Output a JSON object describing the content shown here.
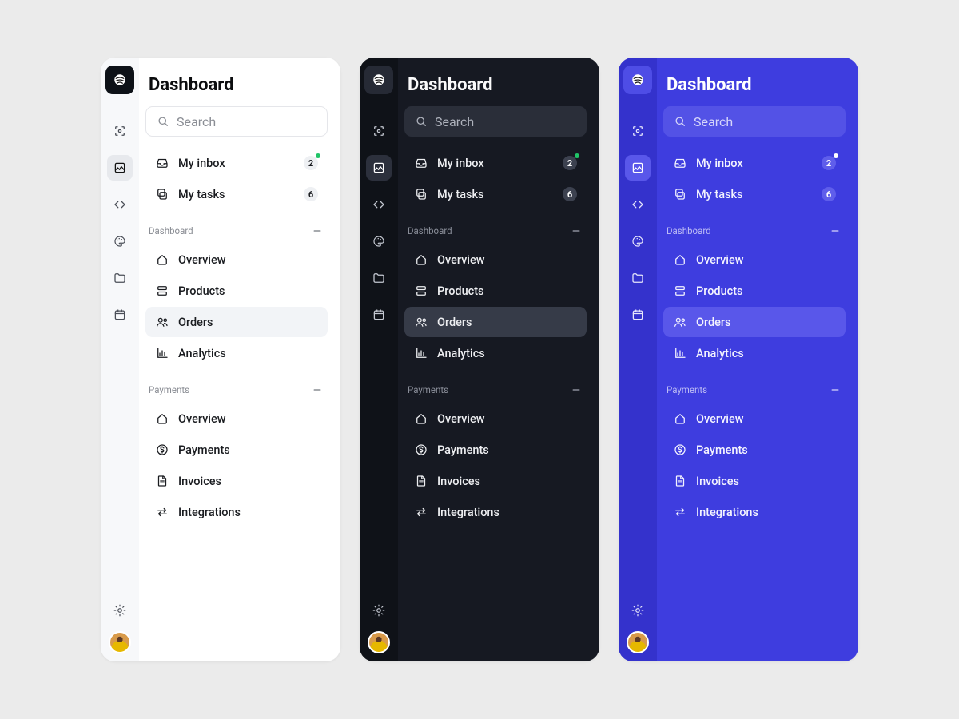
{
  "title": "Dashboard",
  "search_placeholder": "Search",
  "rail_icons": [
    "scan-icon",
    "image-icon",
    "code-icon",
    "palette-icon",
    "folder-icon",
    "calendar-icon"
  ],
  "rail_selected_index": 1,
  "rail_footer_icon": "gear-icon",
  "personal": [
    {
      "icon": "inbox-icon",
      "label": "My inbox",
      "count": "2",
      "dot": true
    },
    {
      "icon": "tasks-icon",
      "label": "My tasks",
      "count": "6",
      "dot": false
    }
  ],
  "sections": [
    {
      "name": "Dashboard",
      "items": [
        {
          "icon": "home-icon",
          "label": "Overview",
          "sel": false
        },
        {
          "icon": "stack-icon",
          "label": "Products",
          "sel": false
        },
        {
          "icon": "users-icon",
          "label": "Orders",
          "sel": true
        },
        {
          "icon": "chart-icon",
          "label": "Analytics",
          "sel": false
        }
      ]
    },
    {
      "name": "Payments",
      "items": [
        {
          "icon": "home-icon",
          "label": "Overview",
          "sel": false
        },
        {
          "icon": "dollar-icon",
          "label": "Payments",
          "sel": false
        },
        {
          "icon": "file-icon",
          "label": "Invoices",
          "sel": false
        },
        {
          "icon": "swap-icon",
          "label": "Integrations",
          "sel": false
        }
      ]
    }
  ],
  "themes": [
    "light",
    "dark",
    "accent"
  ],
  "colors": {
    "accent": "#3E3DDF",
    "dark": "#161922",
    "light": "#FFFFFF",
    "green": "#20C467"
  }
}
